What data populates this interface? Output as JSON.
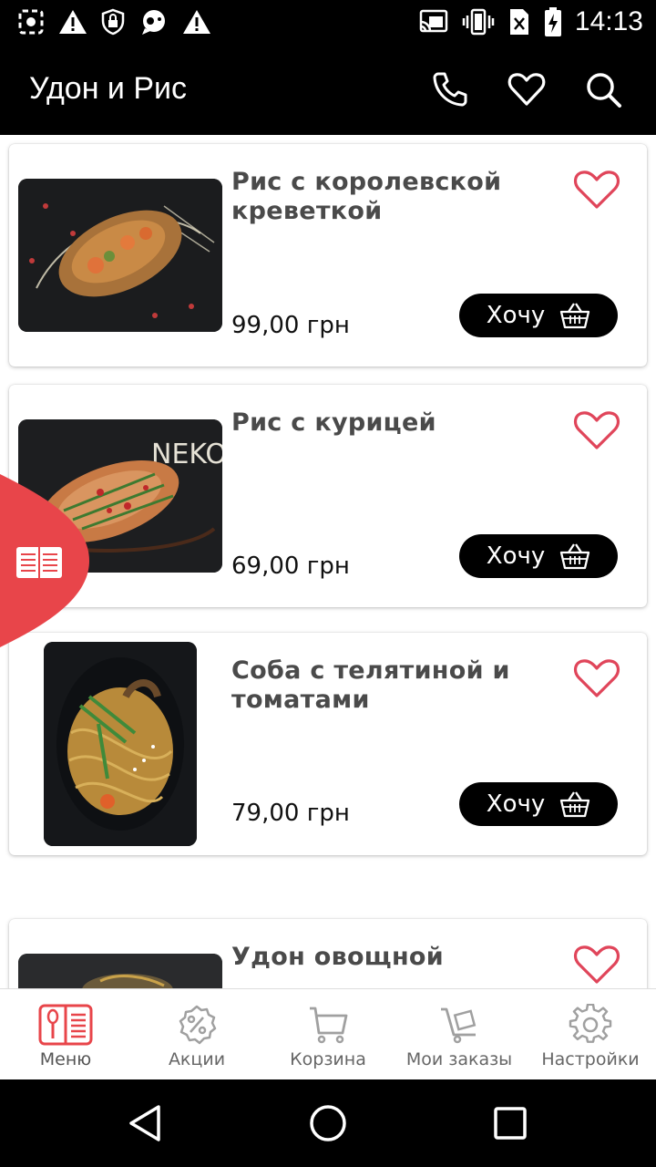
{
  "status_bar": {
    "time": "14:13",
    "left_icons": [
      "screenshot-icon",
      "warning-icon",
      "vpn-shield-icon",
      "chat-icon",
      "warning-icon"
    ],
    "right_icons": [
      "cast-icon",
      "vibrate-icon",
      "no-sim-icon",
      "battery-icon"
    ]
  },
  "app_bar": {
    "title": "Удон и Рис",
    "actions": [
      "phone-icon",
      "heart-icon",
      "search-icon"
    ]
  },
  "products": [
    {
      "name": "Рис с королевской креветкой",
      "price": "99,00 грн",
      "button_label": "Хочу"
    },
    {
      "name": "Рис с курицей",
      "price": "69,00 грн",
      "button_label": "Хочу"
    },
    {
      "name": "Соба с телятиной и томатами",
      "price": "79,00 грн",
      "button_label": "Хочу"
    },
    {
      "name": "Удон овощной"
    }
  ],
  "bottom_nav": {
    "items": [
      {
        "label": "Меню",
        "icon": "menu-book-icon",
        "active": true
      },
      {
        "label": "Акции",
        "icon": "discount-icon",
        "active": false
      },
      {
        "label": "Корзина",
        "icon": "cart-icon",
        "active": false
      },
      {
        "label": "Мои заказы",
        "icon": "delivery-cart-icon",
        "active": false
      },
      {
        "label": "Настройки",
        "icon": "gear-icon",
        "active": false
      }
    ]
  },
  "colors": {
    "accent": "#e8454a",
    "heart": "#e0455a",
    "bar_background": "#000000",
    "nav_icon": "#a0a0a0"
  }
}
